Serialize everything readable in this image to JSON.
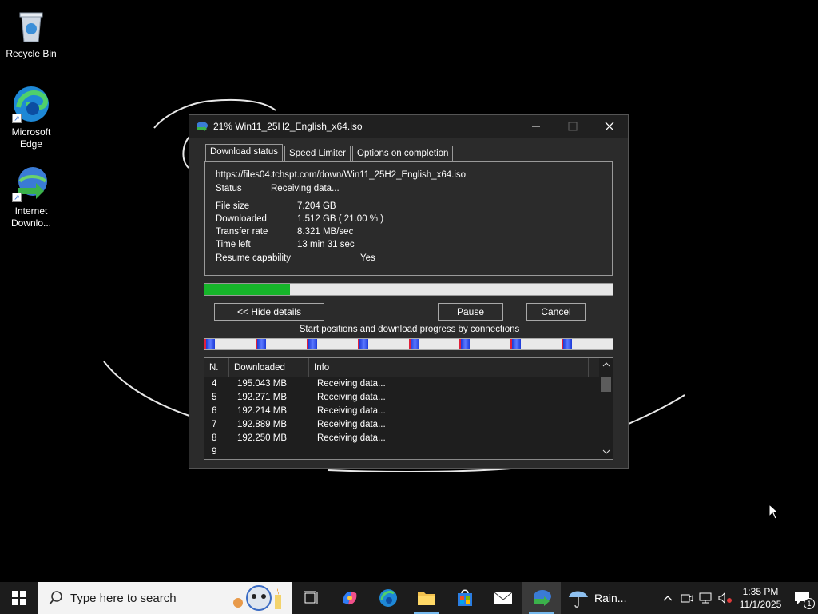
{
  "desktop": {
    "icons": [
      {
        "label": "Recycle Bin",
        "icon": "recycle-bin-icon"
      },
      {
        "label": "Microsoft Edge",
        "icon": "edge-icon"
      },
      {
        "label": "Internet Downlo...",
        "icon": "idm-icon"
      }
    ]
  },
  "window": {
    "title": "21% Win11_25H2_English_x64.iso",
    "tabs": [
      "Download status",
      "Speed Limiter",
      "Options on completion"
    ],
    "active_tab": "Download status",
    "url": "https://files04.tchspt.com/down/Win11_25H2_English_x64.iso",
    "status_label": "Status",
    "status_value": "Receiving data...",
    "file_size_label": "File size",
    "file_size_value": "7.204  GB",
    "downloaded_label": "Downloaded",
    "downloaded_value": "1.512  GB  ( 21.00 % )",
    "transfer_rate_label": "Transfer rate",
    "transfer_rate_value": "8.321  MB/sec",
    "time_left_label": "Time left",
    "time_left_value": "13 min 31 sec",
    "resume_label": "Resume capability",
    "resume_value": "Yes",
    "progress": 0.21,
    "hide_details_label": "<< Hide details",
    "pause_label": "Pause",
    "cancel_label": "Cancel",
    "connections_label": "Start positions and download progress by connections",
    "connection_segments": 8,
    "table": {
      "headers": [
        "N.",
        "Downloaded",
        "Info"
      ],
      "rows": [
        {
          "n": "4",
          "downloaded": "195.043  MB",
          "info": "Receiving data..."
        },
        {
          "n": "5",
          "downloaded": "192.271  MB",
          "info": "Receiving data..."
        },
        {
          "n": "6",
          "downloaded": "192.214  MB",
          "info": "Receiving data..."
        },
        {
          "n": "7",
          "downloaded": "192.889  MB",
          "info": "Receiving data..."
        },
        {
          "n": "8",
          "downloaded": "192.250  MB",
          "info": "Receiving data..."
        },
        {
          "n": "9",
          "downloaded": "",
          "info": ""
        }
      ]
    }
  },
  "taskbar": {
    "search_placeholder": "Type here to search",
    "weather_text": "Rain...",
    "time": "1:35 PM",
    "date": "11/1/2025",
    "notification_count": "1",
    "active_accent": "#76b9ed"
  }
}
